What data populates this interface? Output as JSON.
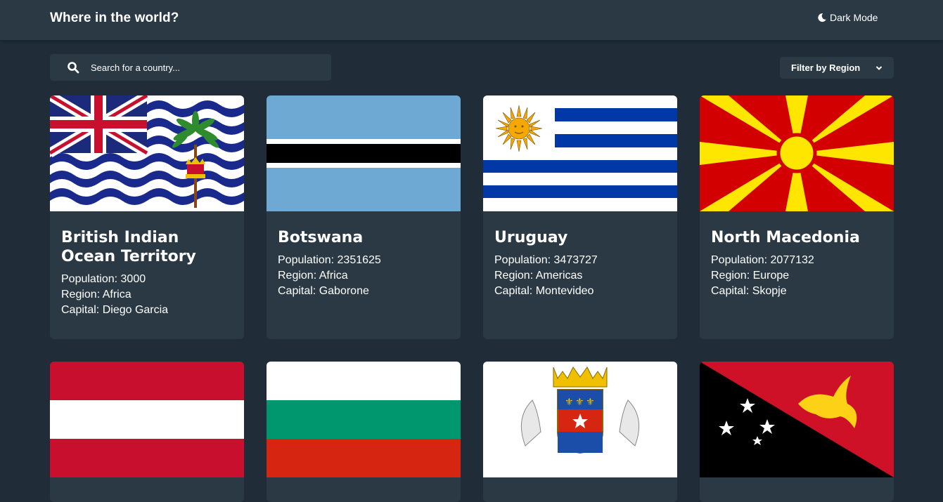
{
  "header": {
    "title": "Where in the world?",
    "theme_toggle_label": "Dark Mode"
  },
  "search": {
    "placeholder": "Search for a country..."
  },
  "filter": {
    "label": "Filter by Region"
  },
  "labels": {
    "population": "Population:",
    "region": "Region:",
    "capital": "Capital:"
  },
  "countries": [
    {
      "name": "British Indian Ocean Territory",
      "population": "3000",
      "region": "Africa",
      "capital": "Diego Garcia"
    },
    {
      "name": "Botswana",
      "population": "2351625",
      "region": "Africa",
      "capital": "Gaborone"
    },
    {
      "name": "Uruguay",
      "population": "3473727",
      "region": "Americas",
      "capital": "Montevideo"
    },
    {
      "name": "North Macedonia",
      "population": "2077132",
      "region": "Europe",
      "capital": "Skopje"
    }
  ],
  "colors": {
    "background": "#202c37",
    "surface": "#2b3945",
    "text": "#ffffff"
  }
}
